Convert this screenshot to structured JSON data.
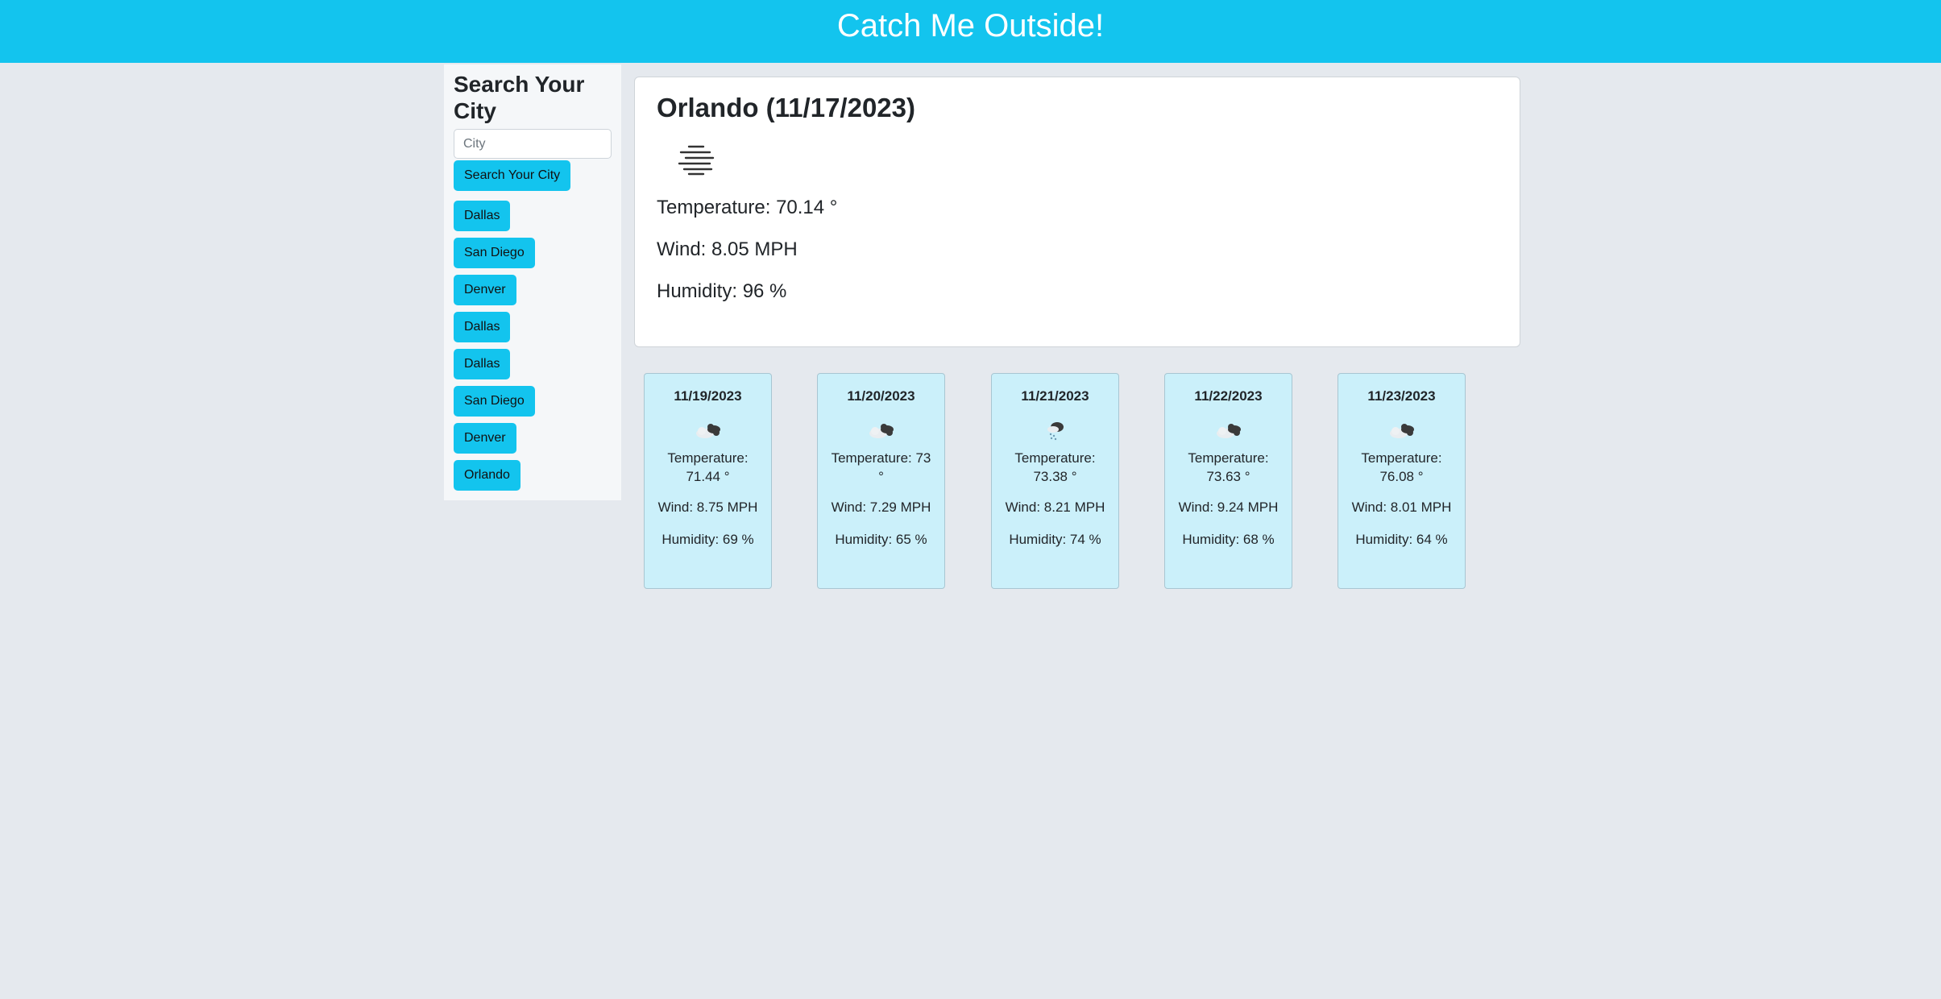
{
  "header": {
    "title": "Catch Me Outside!"
  },
  "sidebar": {
    "heading": "Search Your City",
    "search_placeholder": "City",
    "search_button": "Search Your City",
    "history": [
      "Dallas",
      "San Diego",
      "Denver",
      "Dallas",
      "Dallas",
      "San Diego",
      "Denver",
      "Orlando"
    ]
  },
  "current": {
    "title": "Orlando (11/17/2023)",
    "icon": "mist-icon",
    "temperature": "Temperature: 70.14 °",
    "wind": "Wind: 8.05 MPH",
    "humidity": "Humidity: 96 %"
  },
  "forecast": [
    {
      "date": "11/19/2023",
      "icon": "broken-clouds-icon",
      "temperature": "Temperature: 71.44 °",
      "wind": "Wind: 8.75 MPH",
      "humidity": "Humidity: 69 %"
    },
    {
      "date": "11/20/2023",
      "icon": "broken-clouds-icon",
      "temperature": "Temperature: 73 °",
      "wind": "Wind: 7.29 MPH",
      "humidity": "Humidity: 65 %"
    },
    {
      "date": "11/21/2023",
      "icon": "rain-icon",
      "temperature": "Temperature: 73.38 °",
      "wind": "Wind: 8.21 MPH",
      "humidity": "Humidity: 74 %"
    },
    {
      "date": "11/22/2023",
      "icon": "broken-clouds-icon",
      "temperature": "Temperature: 73.63 °",
      "wind": "Wind: 9.24 MPH",
      "humidity": "Humidity: 68 %"
    },
    {
      "date": "11/23/2023",
      "icon": "broken-clouds-icon",
      "temperature": "Temperature: 76.08 °",
      "wind": "Wind: 8.01 MPH",
      "humidity": "Humidity: 64 %"
    }
  ],
  "colors": {
    "accent": "#13c4ee",
    "background": "#e5e9ee",
    "card": "#cbf0fa"
  }
}
